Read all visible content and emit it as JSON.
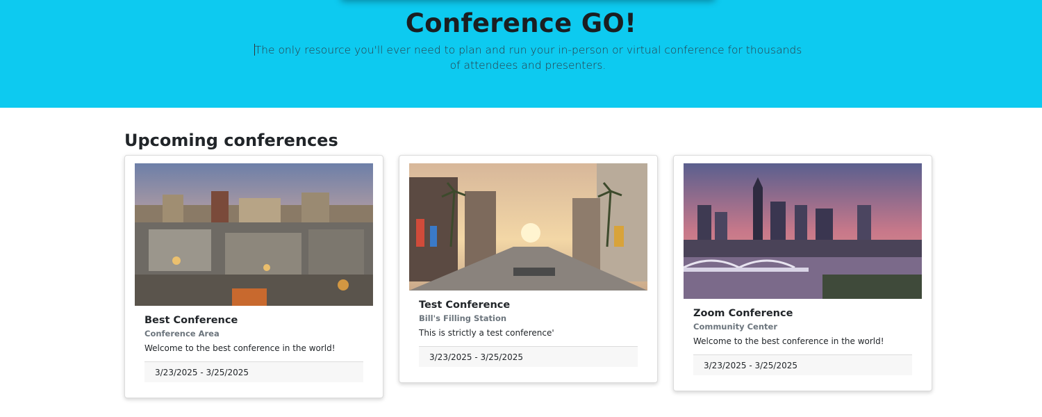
{
  "hero": {
    "title": "Conference GO!",
    "lead": "The only resource you'll ever need to plan and run your in-person or virtual conference for thousands of attendees and presenters."
  },
  "section_title": "Upcoming conferences",
  "conferences": [
    {
      "name": "Best Conference",
      "venue": "Conference Area",
      "description": "Welcome to the best conference in the world!",
      "dates": "3/23/2025 - 3/25/2025",
      "image": "city-castle-photo"
    },
    {
      "name": "Test Conference",
      "venue": "Bill's Filling Station",
      "description": "This is strictly a test conference'",
      "dates": "3/23/2025 - 3/25/2025",
      "image": "street-palms-photo"
    },
    {
      "name": "Zoom Conference",
      "venue": "Community Center",
      "description": "Welcome to the best conference in the world!",
      "dates": "3/23/2025 - 3/25/2025",
      "image": "skyline-river-photo"
    }
  ],
  "colors": {
    "hero_bg": "#0dcaf0",
    "footer_bg": "#f7f7f7"
  }
}
